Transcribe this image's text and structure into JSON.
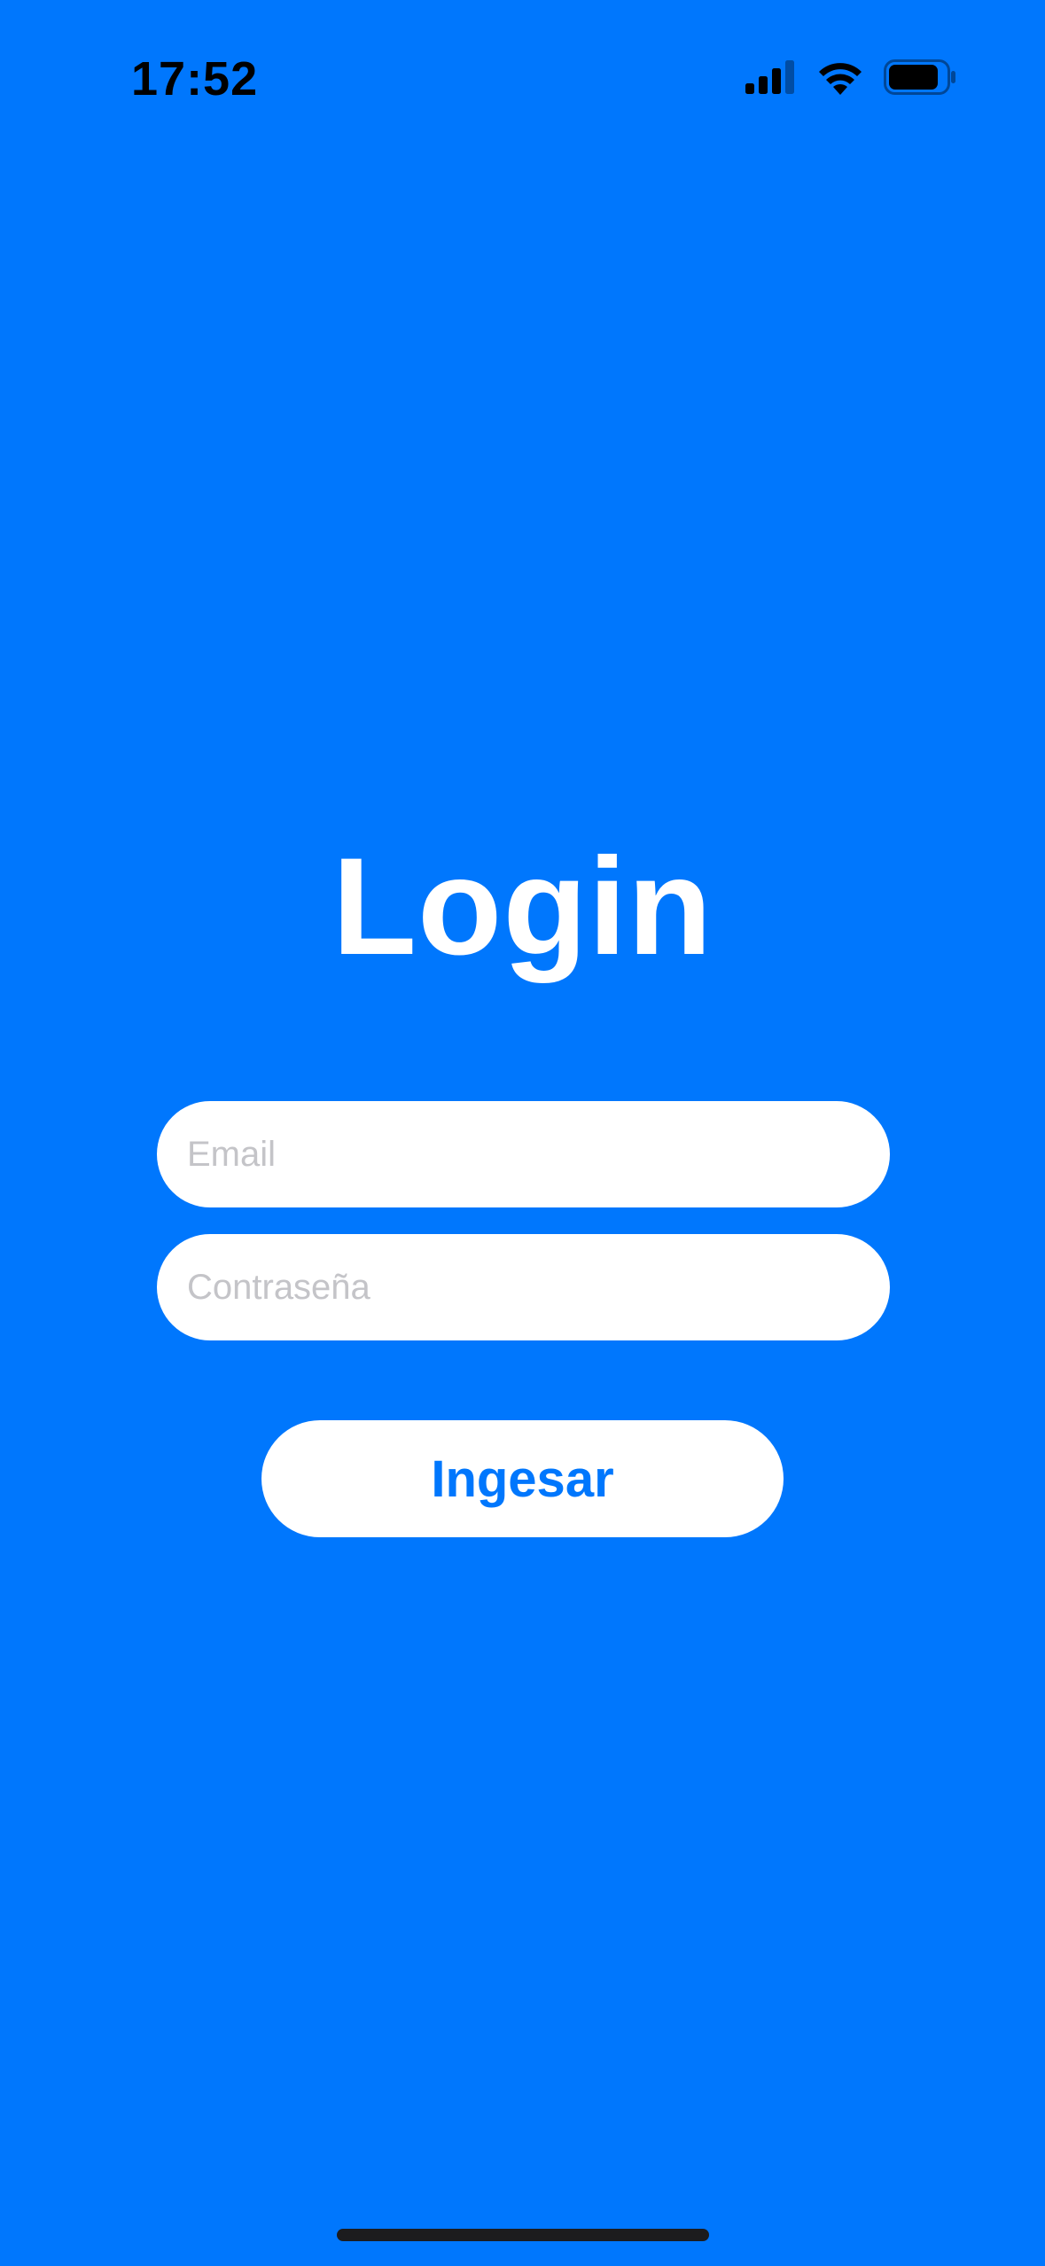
{
  "status_bar": {
    "time": "17:52",
    "icons": [
      "cellular-signal-icon",
      "wifi-icon",
      "battery-icon"
    ]
  },
  "login": {
    "title": "Login",
    "email_placeholder": "Email",
    "email_value": "",
    "password_placeholder": "Contraseña",
    "password_value": "",
    "submit_label": "Ingesar"
  },
  "colors": {
    "background": "#0077FD",
    "accent": "#0077FD",
    "field_background": "#FFFFFF",
    "placeholder": "#C4C4C8",
    "status_text": "#000000"
  }
}
